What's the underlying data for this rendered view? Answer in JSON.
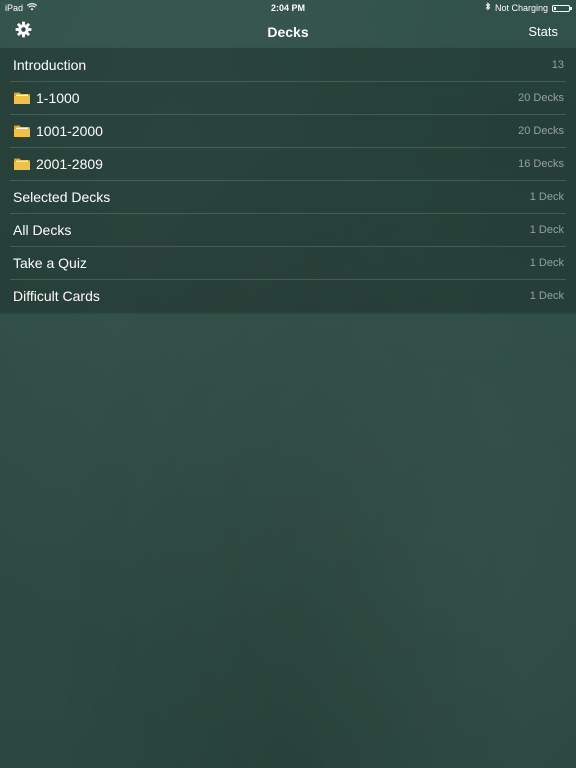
{
  "status_bar": {
    "device": "iPad",
    "time": "2:04 PM",
    "charging_text": "Not Charging",
    "battery_level": 0.15,
    "icons": [
      "wifi-icon",
      "bluetooth-icon",
      "battery-icon"
    ]
  },
  "nav": {
    "title": "Decks",
    "stats_label": "Stats",
    "settings_icon": "gear-icon"
  },
  "decks": [
    {
      "label": "Introduction",
      "count": "13",
      "icon": null
    },
    {
      "label": "1-1000",
      "count": "20 Decks",
      "icon": "folder-icon"
    },
    {
      "label": "1001-2000",
      "count": "20 Decks",
      "icon": "folder-icon"
    },
    {
      "label": "2001-2809",
      "count": "16 Decks",
      "icon": "folder-icon"
    },
    {
      "label": "Selected Decks",
      "count": "1 Deck",
      "icon": null
    },
    {
      "label": "All Decks",
      "count": "1 Deck",
      "icon": null
    },
    {
      "label": "Take a Quiz",
      "count": "1 Deck",
      "icon": null
    },
    {
      "label": "Difficult Cards",
      "count": "1 Deck",
      "icon": null
    }
  ],
  "colors": {
    "background": "#2c4a41",
    "folder": "#f2c044",
    "text": "#ffffff",
    "count_text": "#9aa8a3"
  }
}
